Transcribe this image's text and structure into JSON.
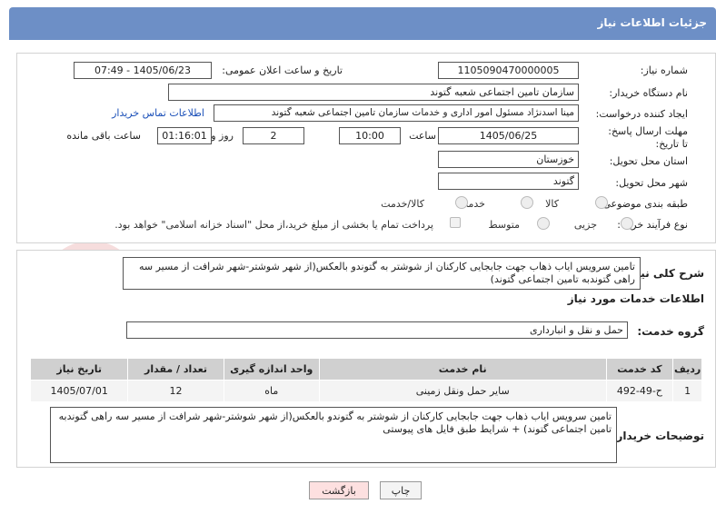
{
  "header": {
    "title": "جزئیات اطلاعات نیاز"
  },
  "form": {
    "need_number_label": "شماره نیاز:",
    "need_number": "1105090470000005",
    "announce_label": "تاریخ و ساعت اعلان عمومی:",
    "announce_value": "1405/06/23 - 07:49",
    "buyer_org_label": "نام دستگاه خریدار:",
    "buyer_org": "سازمان تامین اجتماعی شعبه گتوند",
    "creator_label": "ایجاد کننده درخواست:",
    "creator": "مینا اسدنژاد مسئول امور اداری و خدمات سازمان تامین اجتماعی شعبه گتوند",
    "contact_link": "اطلاعات تماس خریدار",
    "deadline_label": "مهلت ارسال پاسخ: تا تاریخ:",
    "deadline_date": "1405/06/25",
    "time_label": "ساعت",
    "deadline_time": "10:00",
    "days_value": "2",
    "days_label": "روز و",
    "remaining_time": "01:16:01",
    "remaining_label": "ساعت باقی مانده",
    "province_label": "استان محل تحویل:",
    "province": "خوزستان",
    "city_label": "شهر محل تحویل:",
    "city": "گتوند",
    "category_label": "طبقه بندی موضوعی:",
    "category_options": [
      "کالا",
      "خدمت",
      "کالا/خدمت"
    ],
    "process_label": "نوع فرآیند خرید :",
    "process_options": [
      "جزیی",
      "متوسط"
    ],
    "payment_note": "پرداخت تمام یا بخشی از مبلغ خرید،از محل \"اسناد خزانه اسلامی\" خواهد بود."
  },
  "details": {
    "summary_label": "شرح کلی نیاز:",
    "summary": "تامین سرویس ایاب ذهاب جهت جابجایی کارکنان از شوشتر به گتوندو بالعکس(از شهر شوشتر-شهر شرافت از مسیر سه راهی گتوندبه تامین اجتماعی گتوند)",
    "services_heading": "اطلاعات خدمات مورد نیاز",
    "service_group_label": "گروه خدمت:",
    "service_group": "حمل و نقل و انبارداری",
    "table": {
      "headers": [
        "ردیف",
        "کد خدمت",
        "نام خدمت",
        "واحد اندازه گیری",
        "تعداد / مقدار",
        "تاریخ نیاز"
      ],
      "rows": [
        [
          "1",
          "ح-49-492",
          "سایر حمل ونقل زمینی",
          "ماه",
          "12",
          "1405/07/01"
        ]
      ]
    },
    "buyer_desc_label": "توضیحات خریدار:",
    "buyer_desc": "تامین سرویس ایاب ذهاب جهت جابجایی کارکنان از شوشتر به گتوندو بالعکس(از شهر شوشتر-شهر شرافت از مسیر سه راهی گتوندبه تامین اجتماعی گتوند) + شرایط طبق فایل های پیوستی"
  },
  "buttons": {
    "print": "چاپ",
    "back": "بازگشت"
  },
  "watermark": {
    "text": "AriaTender.net"
  },
  "colors": {
    "header_bg": "#6d8fc6",
    "back_bg": "#fde0e0",
    "link": "#1a4fb8"
  }
}
